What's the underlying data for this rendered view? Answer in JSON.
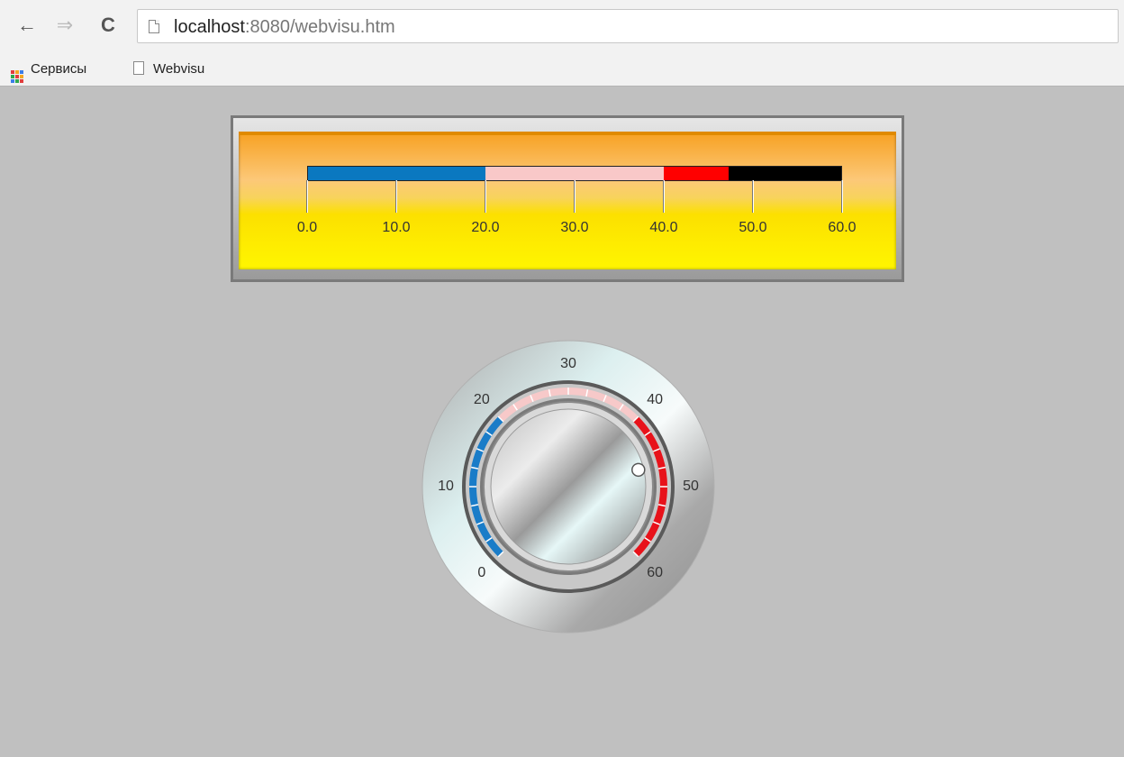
{
  "browser": {
    "nav": {
      "back_icon": "←",
      "forward_icon": "⇒",
      "reload_icon": "C"
    },
    "url": {
      "host": "localhost",
      "rest": ":8080/webvisu.htm"
    },
    "bookmarks": [
      {
        "label": "Сервисы",
        "icon": "apps-grid-icon"
      },
      {
        "label": "Webvisu",
        "icon": "page-icon"
      }
    ]
  },
  "bar_meter": {
    "scale_min": 0,
    "scale_max": 60,
    "tick_labels": [
      "0.0",
      "10.0",
      "20.0",
      "30.0",
      "40.0",
      "50.0",
      "60.0"
    ],
    "ranges": [
      {
        "from": 0,
        "to": 20,
        "color": "#0a78c0"
      },
      {
        "from": 20,
        "to": 40,
        "color": "#f9c8c8"
      },
      {
        "from": 40,
        "to": 47.3,
        "color": "#ff0000"
      },
      {
        "from": 47.3,
        "to": 60,
        "color": "#000000"
      }
    ]
  },
  "knob": {
    "scale_min": 0,
    "scale_max": 60,
    "labels": [
      "0",
      "10",
      "20",
      "30",
      "40",
      "50",
      "60"
    ],
    "value": 47,
    "ranges": [
      {
        "from": 0,
        "to": 20,
        "color": "#1a7cc8"
      },
      {
        "from": 20,
        "to": 40,
        "color": "#f7c9c9"
      },
      {
        "from": 40,
        "to": 60,
        "color": "#e8121a"
      }
    ]
  }
}
